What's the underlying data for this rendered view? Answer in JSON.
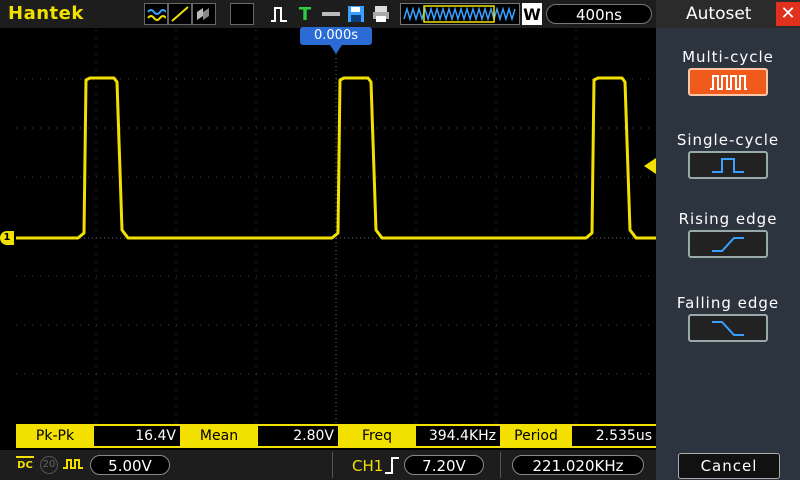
{
  "header": {
    "brand": "Hantek",
    "run_state_icon": "waveform-icon",
    "timebase": "400ns"
  },
  "screen": {
    "time_offset": "0.000s",
    "channel_marker": "1",
    "trace_color": "#f2e100"
  },
  "measurements": [
    {
      "label": "Pk-Pk",
      "value": "16.4V"
    },
    {
      "label": "Mean",
      "value": "2.80V"
    },
    {
      "label": "Freq",
      "value": "394.4KHz"
    },
    {
      "label": "Period",
      "value": "2.535us"
    }
  ],
  "status": {
    "coupling": "DC",
    "bw_limit": "20",
    "ch1_scale": "5.00V",
    "trigger_channel": "CH1",
    "trigger_level": "7.20V",
    "trigger_freq": "221.020KHz"
  },
  "autoset": {
    "title": "Autoset",
    "options": [
      {
        "label": "Multi-cycle",
        "icon": "multi-cycle-icon",
        "active": true
      },
      {
        "label": "Single-cycle",
        "icon": "single-cycle-icon",
        "active": false
      },
      {
        "label": "Rising edge",
        "icon": "rising-edge-icon",
        "active": false
      },
      {
        "label": "Falling edge",
        "icon": "falling-edge-icon",
        "active": false
      }
    ],
    "cancel_label": "Cancel"
  },
  "colors": {
    "trace": "#f2e100",
    "accent": "#f05a1a",
    "marker_blue": "#2a6bd6",
    "close_red": "#e0301e"
  }
}
